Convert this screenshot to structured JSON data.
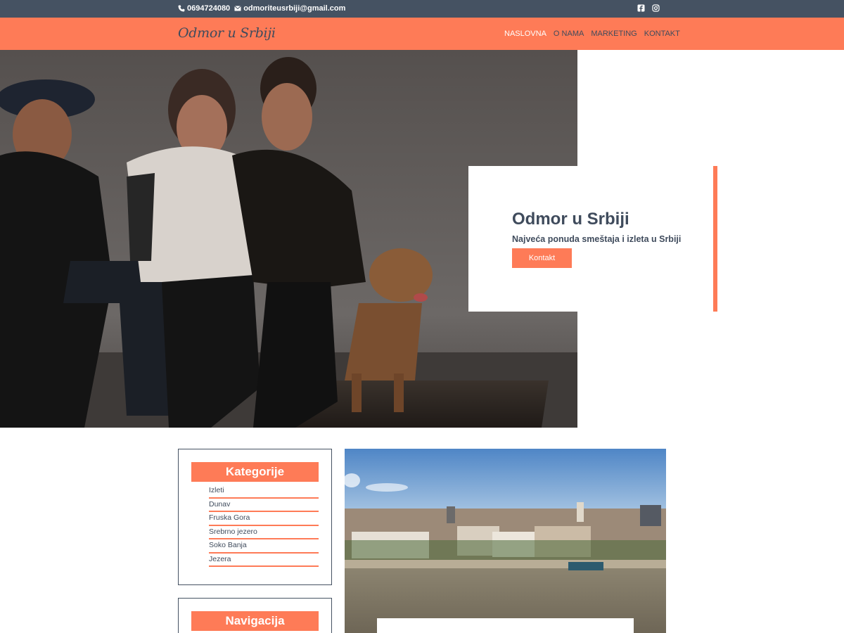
{
  "topbar": {
    "phone": "0694724080",
    "email": "odmoriteusrbiji@gmail.com",
    "social": [
      "facebook-icon",
      "instagram-icon"
    ]
  },
  "nav": {
    "brand": "Odmor u Srbiji",
    "items": [
      {
        "label": "NASLOVNA",
        "active": true
      },
      {
        "label": "O NAMA",
        "active": false
      },
      {
        "label": "MARKETING",
        "active": false
      },
      {
        "label": "KONTAKT",
        "active": false
      }
    ]
  },
  "hero": {
    "title": "Odmor u Srbiji",
    "subtitle": "Najveća ponuda smeštaja i izleta u Srbiji",
    "button": "Kontakt"
  },
  "sidebar": {
    "categories_title": "Kategorije",
    "categories": [
      "Izleti",
      "Dunav",
      "Fruska Gora",
      "Srebrno jezero",
      "Soko Banja",
      "Jezera"
    ],
    "navigation_title": "Navigacija"
  },
  "colors": {
    "accent": "#fe7b57",
    "dark": "#455262",
    "text": "#3f4b5c"
  }
}
